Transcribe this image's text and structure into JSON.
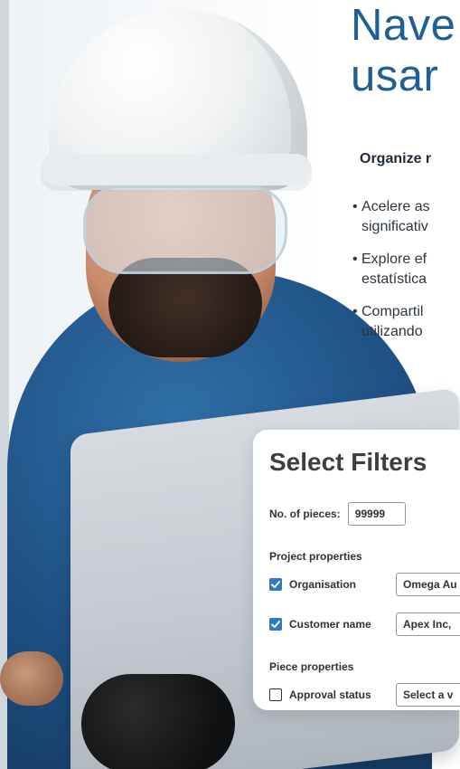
{
  "hero": {
    "title": "Nave\nusar",
    "subtitle": "Organize r",
    "bullets": [
      "Acelere as",
      "significativ",
      "Explore ef",
      "estatística",
      "Compartil",
      "utilizando"
    ]
  },
  "filters_panel": {
    "title": "Select Filters",
    "pieces_label": "No. of pieces:",
    "pieces_value": "99999",
    "project_properties_label": "Project properties",
    "organisation_label": "Organisation",
    "organisation_value": "Omega Au",
    "customer_name_label": "Customer name",
    "customer_name_value": "Apex Inc,",
    "piece_properties_label": "Piece properties",
    "approval_status_label": "Approval status",
    "approval_status_value": "Select a v"
  },
  "colors": {
    "brand_blue": "#1f5f95",
    "checkbox_blue": "#2f78c4"
  }
}
